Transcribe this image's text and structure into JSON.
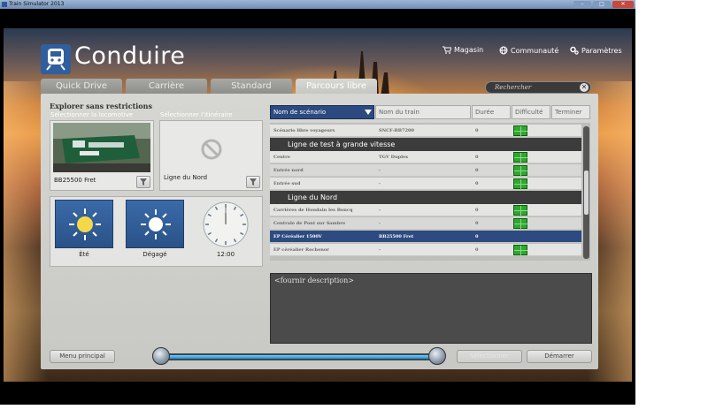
{
  "window": {
    "title": "Train Simulator 2013"
  },
  "app": {
    "title": "Conduire"
  },
  "topnav": [
    {
      "label": "Magasin",
      "icon": "cart-icon"
    },
    {
      "label": "Communauté",
      "icon": "globe-icon"
    },
    {
      "label": "Paramètres",
      "icon": "gears-icon"
    }
  ],
  "tabs": [
    "Quick Drive",
    "Carrière",
    "Standard",
    "Parcours libre"
  ],
  "active_tab": "Parcours libre",
  "search": {
    "placeholder": "Rechercher"
  },
  "left": {
    "title": "Explorer sans restrictions",
    "loco_label": "Sélectionner la locomotive",
    "route_label": "Sélectionner l'itinéraire",
    "loco_value": "BB25500 Fret",
    "route_value": "Ligne du Nord",
    "weather": [
      {
        "label": "Été",
        "icon": "sun-summer-icon"
      },
      {
        "label": "Dégagé",
        "icon": "sun-clear-icon"
      }
    ],
    "time": {
      "value": "12:00",
      "hour": 12,
      "minute": 0
    }
  },
  "table": {
    "headers": [
      "Nom de scénario",
      "Nom du train",
      "Durée",
      "Difficulté",
      "Terminer"
    ],
    "selected_header": "Nom de scénario",
    "top_row": {
      "name": "Scénario libre voyageurs",
      "train": "SNCF-BB7200",
      "duration": "0"
    },
    "groups": [
      {
        "title": "Ligne de test à grande vitesse",
        "rows": [
          {
            "name": "Centre",
            "train": "TGV Duplex",
            "duration": "0"
          },
          {
            "name": "Entrée nord",
            "train": "-",
            "duration": "0"
          },
          {
            "name": "Entrée sud",
            "train": "-",
            "duration": "0"
          }
        ]
      },
      {
        "title": "Ligne du Nord",
        "rows": [
          {
            "name": "Carrières de Houdain les Boncq",
            "train": "-",
            "duration": "0"
          },
          {
            "name": "Centrale de Pont sur Sambre",
            "train": "-",
            "duration": "0"
          },
          {
            "name": "EP Céréalier 1500V",
            "train": "BB25500 Fret",
            "duration": "0",
            "selected": true
          },
          {
            "name": "EP céréalier Rochenor",
            "train": "-",
            "duration": "0"
          }
        ]
      }
    ]
  },
  "description": "<fournir description>",
  "bottom": {
    "menu_button": "Menu principal",
    "disabled_button": "Sélectionner",
    "start_button": "Démarrer",
    "slider_value": 1.0
  }
}
